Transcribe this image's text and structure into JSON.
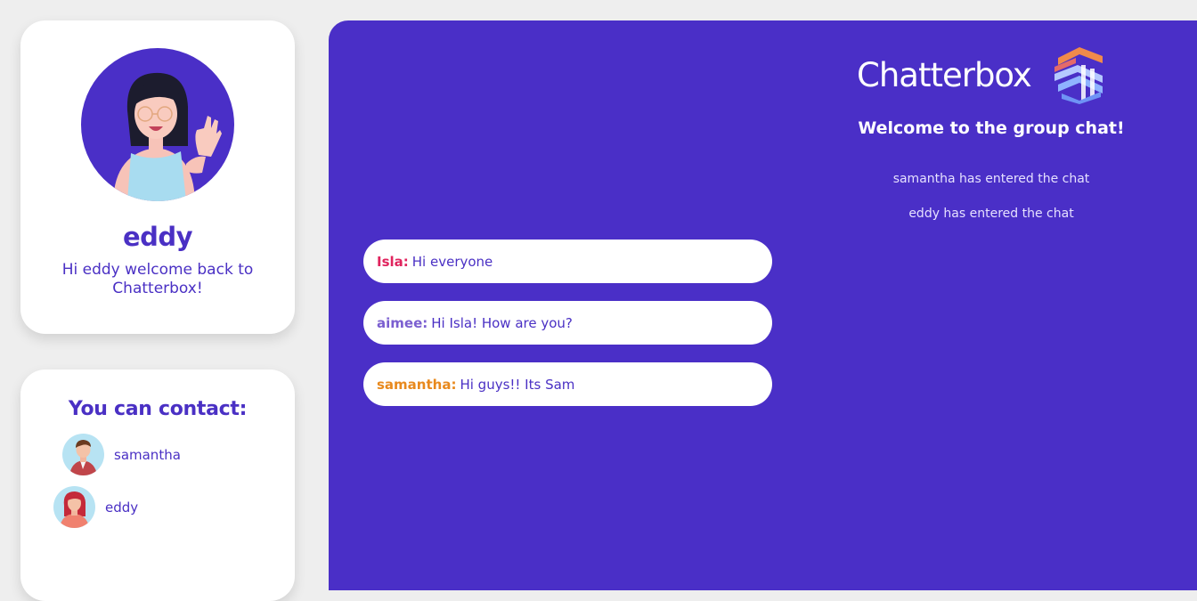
{
  "profile": {
    "name": "eddy",
    "welcome": "Hi eddy welcome back to Chatterbox!"
  },
  "contacts": {
    "title": "You can contact:",
    "items": [
      {
        "name": "samantha",
        "avatar": "man-avatar-icon"
      },
      {
        "name": "eddy",
        "avatar": "woman-avatar-icon"
      }
    ]
  },
  "chat": {
    "logo_text": "Chatterbox",
    "welcome_title": "Welcome to the group chat!",
    "system_messages": [
      "samantha has entered the chat",
      "eddy has entered the chat"
    ],
    "messages": [
      {
        "sender": "Isla:",
        "text": "Hi everyone",
        "color": "#e0245e"
      },
      {
        "sender": "aimee:",
        "text": "Hi Isla! How are you?",
        "color": "#7b5fd0"
      },
      {
        "sender": "samantha:",
        "text": "Hi guys!! Its Sam",
        "color": "#e8891d"
      }
    ]
  },
  "colors": {
    "brand": "#4a2fc7",
    "page_bg": "#eeeeee"
  }
}
